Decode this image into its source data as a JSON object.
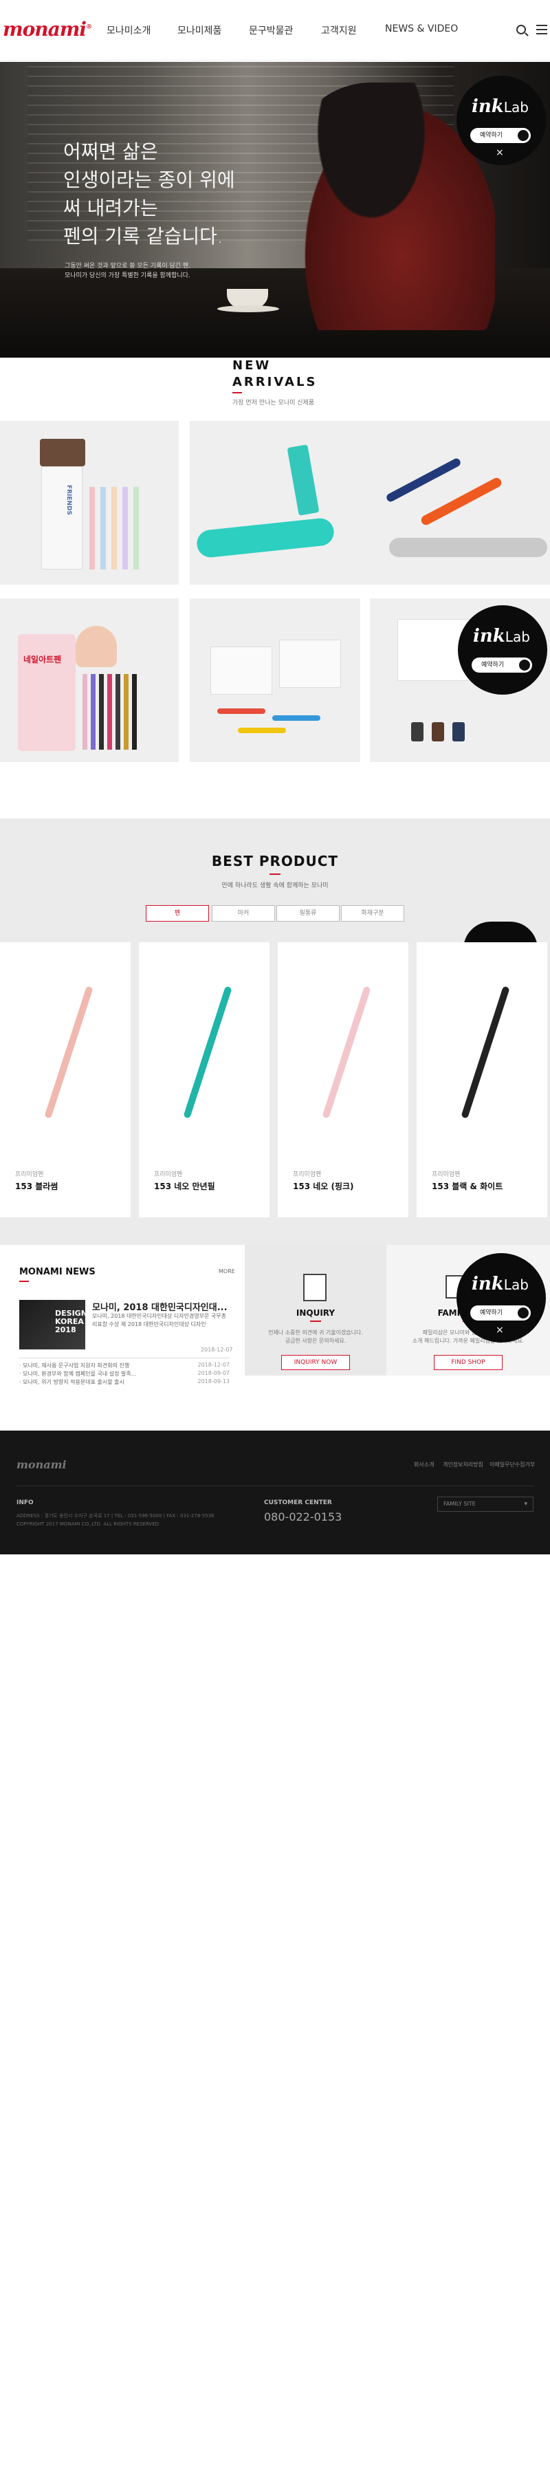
{
  "header": {
    "logo": "monami",
    "nav": [
      "모나미소개",
      "모나미제품",
      "문구박물관",
      "고객지원",
      "NEWS & VIDEO"
    ]
  },
  "hero": {
    "title_lines": [
      "어쩌면 삶은",
      "인생이라는 종이 위에",
      "써 내려가는",
      "펜의 기록 같습니다."
    ],
    "subtitle_lines": [
      "그동안 써온 것과 앞으로 쓸 모든 기록이 담긴 펜.",
      "모나미가 당신의 가장 특별한 기록을 함께합니다."
    ]
  },
  "inklab": {
    "logo": "ink",
    "logo_suffix": "Lab",
    "button": "예약하기",
    "close": "×"
  },
  "new_arrivals": {
    "title_line1": "NEW",
    "title_line2": "ARRIVALS",
    "subtitle": "가장 먼저 만나는 모나미 신제품",
    "pencil_label": "FRIENDS",
    "nail_label": "네일아트펜"
  },
  "best_product": {
    "title": "BEST PRODUCT",
    "subtitle": "만에 하나라도 생활 속에 함께하는 모나미",
    "tabs": [
      "펜",
      "마커",
      "필통류",
      "화재구분"
    ],
    "products": [
      {
        "category": "프리미엄펜",
        "name": "153 블라썸"
      },
      {
        "category": "프리미엄펜",
        "name": "153 네오 만년필"
      },
      {
        "category": "프리미엄펜",
        "name": "153 네오 (핑크)"
      },
      {
        "category": "프리미엄펜",
        "name": "153 블랙 & 화이트"
      }
    ]
  },
  "news": {
    "title": "MONAMI NEWS",
    "more": "MORE",
    "thumb_text": "DESIGN KOREA 2018",
    "headline": "모나미, 2018 대한민국디자인대...",
    "body": "모나미, 2018 대한민국디자인대상 디자인경영부문 국무총리표창 수상 제 2018 대한민국디자인대상 디자인",
    "date": "2018-12-07",
    "items": [
      {
        "text": "· 모나미, 재사용 문구사업 지원자 파견회의 진행",
        "date": "2018-12-07"
      },
      {
        "text": "· 모나미, 환경부와 함께 캠페인을 국내 설정 발족...",
        "date": "2018-09-07"
      },
      {
        "text": "· 모나미, 위기 방향지 적용분대표 출시할 출시",
        "date": "2018-09-13"
      }
    ]
  },
  "inquiry": {
    "title": "INQUIRY",
    "desc_lines": [
      "언제나 소중한 의견에 귀 기울이겠습니다.",
      "궁금한 사항은 문의하세요."
    ],
    "button": "INQUIRY NOW"
  },
  "family": {
    "title": "FAMILY SHOP",
    "desc_lines": [
      "패밀리샵은 모나미와 함께하는 가맹점을",
      "소개 해드립니다. 가까운 패밀리샵을 찾아보세요."
    ],
    "button": "FIND SHOP"
  },
  "footer": {
    "logo": "monami",
    "links": [
      "회사소개",
      "개인정보처리방침",
      "이메일무단수집거부"
    ],
    "info_heading": "INFO",
    "address": "ADDRESS : 경기도 용인시 수지구 손곡로 17  |  TEL : 031-596-5000  |  FAX : 031-278-5536",
    "copyright": "COPYRIGHT 2017 MONAMI CO.,LTD. ALL RIGHTS RESERVED",
    "cc_heading": "CUSTOMER CENTER",
    "phone": "080-022-0153",
    "family_select": "FAMILY SITE"
  },
  "colors": {
    "brand": "#d1132a",
    "footer_bg": "#161616",
    "best_bg": "#ebebeb"
  }
}
